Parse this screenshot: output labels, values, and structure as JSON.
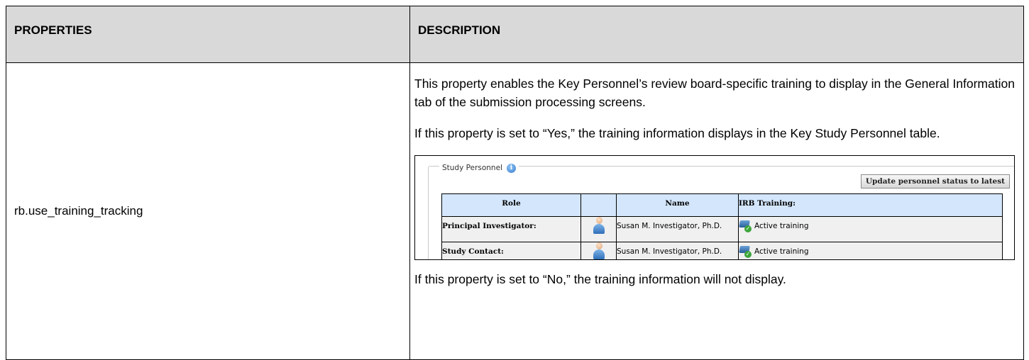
{
  "table": {
    "header": {
      "properties": "PROPERTIES",
      "description": "DESCRIPTION"
    },
    "row": {
      "property": "rb.use_training_tracking",
      "paragraphs": [
        "This property enables the Key Personnel’s review board-specific training to display in the General Information tab of the submission processing screens.",
        "If this property is set to “Yes,” the training information displays in the Key Study Personnel table."
      ],
      "closing": "If this property is set to “No,” the training information will not display."
    }
  },
  "screenshot": {
    "legend": "Study Personnel",
    "legend_icon": "info-icon",
    "update_button": "Update personnel status to latest",
    "columns": [
      "Role",
      "",
      "Name",
      "IRB Training:"
    ],
    "rows": [
      {
        "role": "Principal Investigator:",
        "name": "Susan M. Investigator, Ph.D.",
        "training": "Active training"
      },
      {
        "role": "Study Contact:",
        "name": "Susan M. Investigator, Ph.D.",
        "training": "Active training"
      }
    ],
    "colors": {
      "header_bg": "#d3e6fb",
      "row_bg": "#f0f0f0",
      "table_header_bg": "#d9d9d9"
    }
  }
}
